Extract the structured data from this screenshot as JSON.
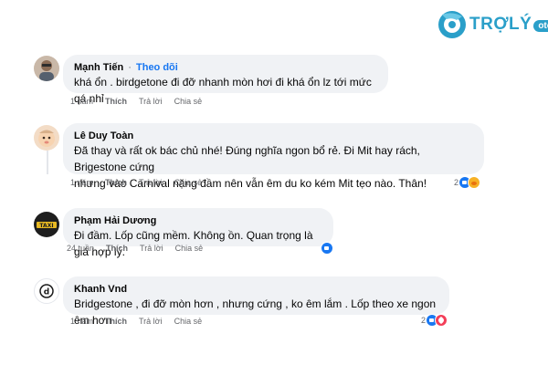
{
  "brand": {
    "name": "TRỢLÝ",
    "badge": "oto"
  },
  "actions": {
    "like": "Thích",
    "reply": "Trả lời",
    "share": "Chia sẻ"
  },
  "comments": [
    {
      "author": "Mạnh Tiến",
      "follow": "Theo dõi",
      "text": "khá ổn . birdgetone đi đỡ nhanh mòn hơi đi khá ổn lz tới mức qá nhỉ",
      "time": "1 năm"
    },
    {
      "author": "Lê Duy Toàn",
      "text_line1": "Đã thay và rất ok bác chủ nhé! Đúng nghĩa ngon bổ rẻ. Đi Mit hay rách, Brigestone cứng",
      "text_line2": "nhưng vào Carnival nặng đầm nên vẫn êm du ko kém Mit tẹo nào. Thân!",
      "time": "1 năm",
      "reaction_count": "2"
    },
    {
      "author": "Phạm Hải Dương",
      "text": "Đi đầm. Lốp cũng mềm. Không ồn. Quan trọng là giá hợp lý.",
      "time": "24 tuần"
    },
    {
      "author": "Khanh Vnd",
      "text": "Bridgestone , đi đỡ mòn hơn , nhưng cứng , ko êm lắm . Lốp theo xe ngon êm hơn .",
      "time": "1 năm",
      "reaction_count": "2"
    }
  ],
  "colors": {
    "bubble": "#f0f2f5",
    "link": "#1877f2",
    "muted": "#65676b",
    "brand": "#2a9fc9"
  }
}
